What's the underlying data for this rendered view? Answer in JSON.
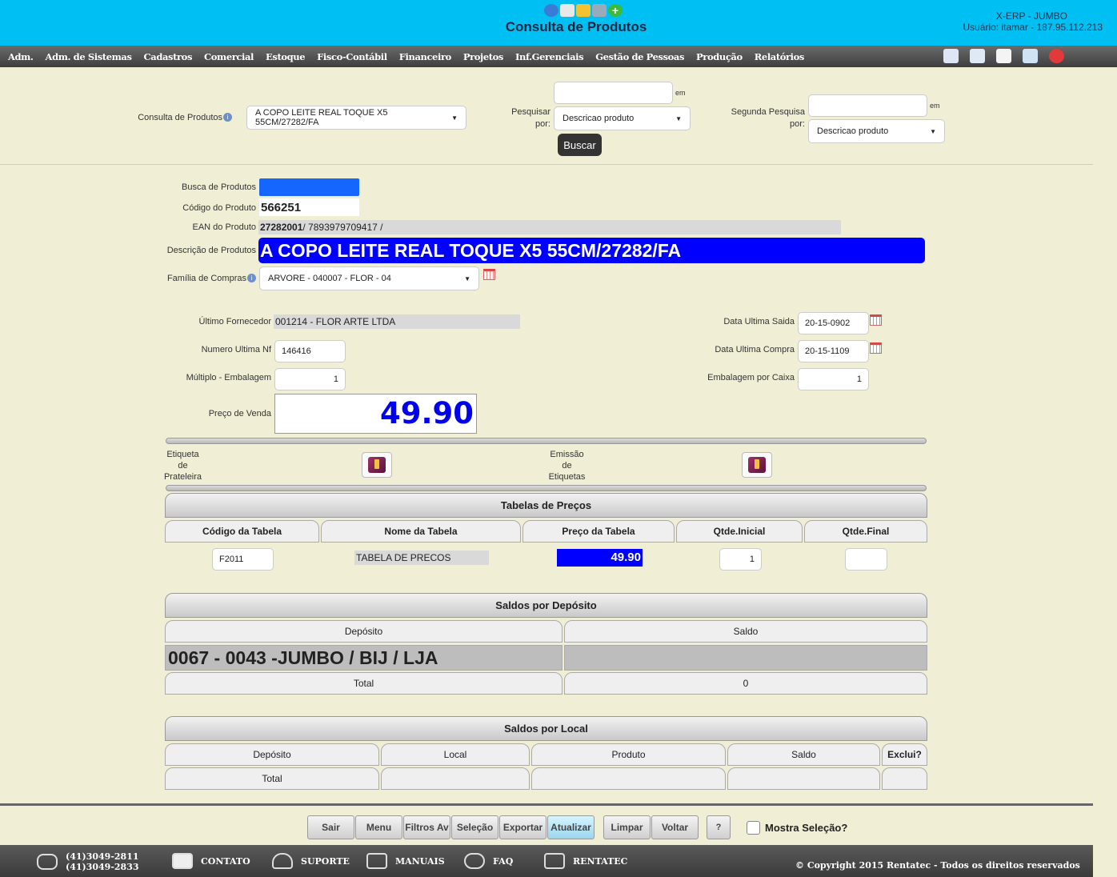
{
  "header": {
    "title": "Consulta de Produtos",
    "system": "X-ERP - JUMBO",
    "user": "Usuário: itamar - 187.95.112.213",
    "app_icons": [
      "globe-icon",
      "document-icon",
      "folder-icon",
      "printer-icon",
      "add-icon"
    ]
  },
  "menu": [
    "Adm.",
    "Adm. de Sistemas",
    "Cadastros",
    "Comercial",
    "Estoque",
    "Fisco-Contábil",
    "Financeiro",
    "Projetos",
    "Inf.Gerenciais",
    "Gestão de Pessoas",
    "Produção",
    "Relatórios"
  ],
  "toolbar_icons": [
    "home-icon",
    "edit-icon",
    "page-icon",
    "refresh-icon",
    "power-icon"
  ],
  "search": {
    "consulta_label": "Consulta de Produtos",
    "consulta_value": "A COPO LEITE REAL TOQUE X5 55CM/27282/FA",
    "pesquisar_label1": "Pesquisar",
    "pesquisar_label2": "por:",
    "em": "em",
    "first_value": "",
    "first_by": "Descricao produto",
    "segunda_label1": "Segunda Pesquisa",
    "segunda_label2": "por:",
    "second_value": "",
    "second_by": "Descricao produto",
    "buscar": "Buscar"
  },
  "product": {
    "busca_label": "Busca de Produtos",
    "codigo_label": "Código do Produto",
    "codigo": "566251",
    "ean_label": "EAN do Produto",
    "ean_bold": "27282001",
    "ean_rest": " / 7893979709417 /",
    "descricao_label": "Descrição de Produtos",
    "descricao": "A COPO LEITE REAL TOQUE X5 55CM/27282/FA",
    "familia_label": "Família de Compras",
    "familia": "ARVORE - 040007 - FLOR - 04",
    "fornecedor_label": "Último Fornecedor",
    "fornecedor": "001214 - FLOR ARTE LTDA",
    "nf_label": "Numero Ultima Nf",
    "nf": "146416",
    "multiplo_label": "Múltiplo - Embalagem",
    "multiplo": "1",
    "preco_label": "Preço de Venda",
    "preco": "49.90",
    "saida_label": "Data Ultima Saida",
    "saida": "20-15-0902",
    "compra_label": "Data Ultima Compra",
    "compra": "20-15-1109",
    "embalagem_label": "Embalagem por Caixa",
    "embalagem": "1"
  },
  "etiquetas": {
    "prateleira": [
      "Etiqueta",
      "de",
      "Prateleira"
    ],
    "emissao": [
      "Emissão",
      "de",
      "Etiquetas"
    ]
  },
  "tabelas": {
    "title": "Tabelas de Preços",
    "cols": [
      "Código da Tabela",
      "Nome da Tabela",
      "Preço da Tabela",
      "Qtde.Inicial",
      "Qtde.Final"
    ],
    "row": {
      "codigo": "F2011",
      "nome": "TABELA DE PRECOS",
      "preco": "49.90",
      "inicial": "1",
      "final": ""
    }
  },
  "deposito": {
    "title": "Saldos por Depósito",
    "cols": [
      "Depósito",
      "Saldo"
    ],
    "row": "0067 - 0043 -JUMBO / BIJ / LJA",
    "total_label": "Total",
    "total": "0"
  },
  "local": {
    "title": "Saldos por Local",
    "cols": [
      "Depósito",
      "Local",
      "Produto",
      "Saldo",
      "Exclui?"
    ],
    "total_label": "Total"
  },
  "actions": [
    "Sair",
    "Menu",
    "Filtros Av",
    "Seleção",
    "Exportar",
    "Atualizar",
    "Limpar",
    "Voltar",
    "?"
  ],
  "mostra": "Mostra Seleção?",
  "footer": {
    "phone1": "(41)3049-2811",
    "phone2": "(41)3049-2833",
    "contato": "CONTATO",
    "suporte": "SUPORTE",
    "manuais": "MANUAIS",
    "faq": "FAQ",
    "rentatec": "RENTATEC",
    "copyright": "© Copyright 2015 Rentatec - Todos os direitos reservados"
  }
}
